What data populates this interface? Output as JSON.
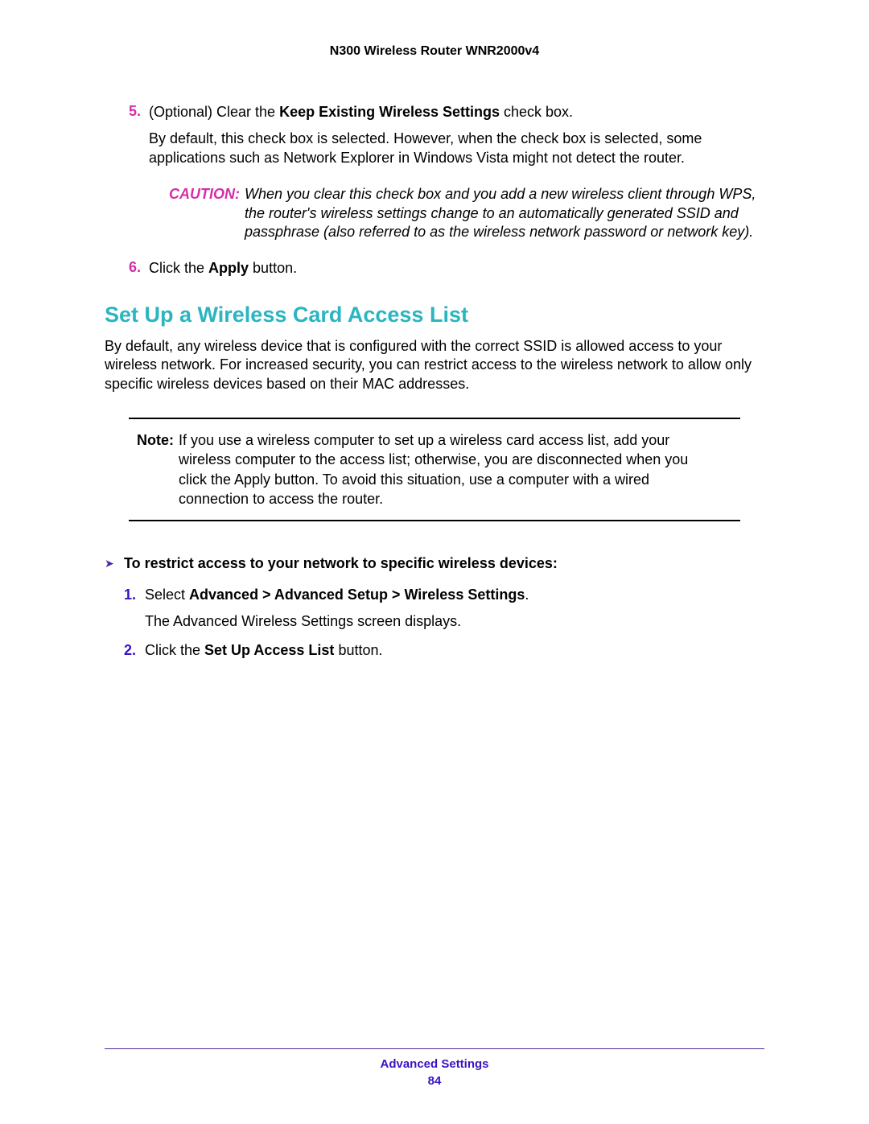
{
  "header": {
    "title": "N300 Wireless Router WNR2000v4"
  },
  "steps": {
    "s5": {
      "num": "5.",
      "lead": "(Optional) Clear the ",
      "bold": "Keep Existing Wireless Settings",
      "tail": " check box.",
      "follow": "By default, this check box is selected. However, when the check box is selected, some applications such as Network Explorer in Windows Vista might not detect the router."
    },
    "caution": {
      "label": "CAUTION:",
      "body": "When you clear this check box and you add a new wireless client through WPS, the router's wireless settings change to an automatically generated SSID and passphrase (also referred to as the wireless network password or network key)."
    },
    "s6": {
      "num": "6.",
      "lead": "Click the ",
      "bold": "Apply",
      "tail": " button."
    }
  },
  "section": {
    "heading": "Set Up a Wireless Card Access List",
    "intro": "By default, any wireless device that is configured with the correct SSID is allowed access to your wireless network. For increased security, you can restrict access to the wireless network to allow only specific wireless devices based on their MAC addresses."
  },
  "note": {
    "label": "Note:",
    "body": "If you use a wireless computer to set up a wireless card access list, add your wireless computer to the access list; otherwise, you are disconnected when you click the Apply button. To avoid this situation, use a computer with a wired connection to access the router."
  },
  "task": {
    "arrow": "➤",
    "title": "To restrict access to your network to specific wireless devices:",
    "steps": {
      "t1": {
        "num": "1.",
        "lead": "Select ",
        "bold": "Advanced > Advanced Setup > Wireless Settings",
        "tail": ".",
        "follow": "The Advanced Wireless Settings screen displays."
      },
      "t2": {
        "num": "2.",
        "lead": "Click the ",
        "bold": "Set Up Access List",
        "tail": " button."
      }
    }
  },
  "footer": {
    "section": "Advanced Settings",
    "page": "84"
  }
}
